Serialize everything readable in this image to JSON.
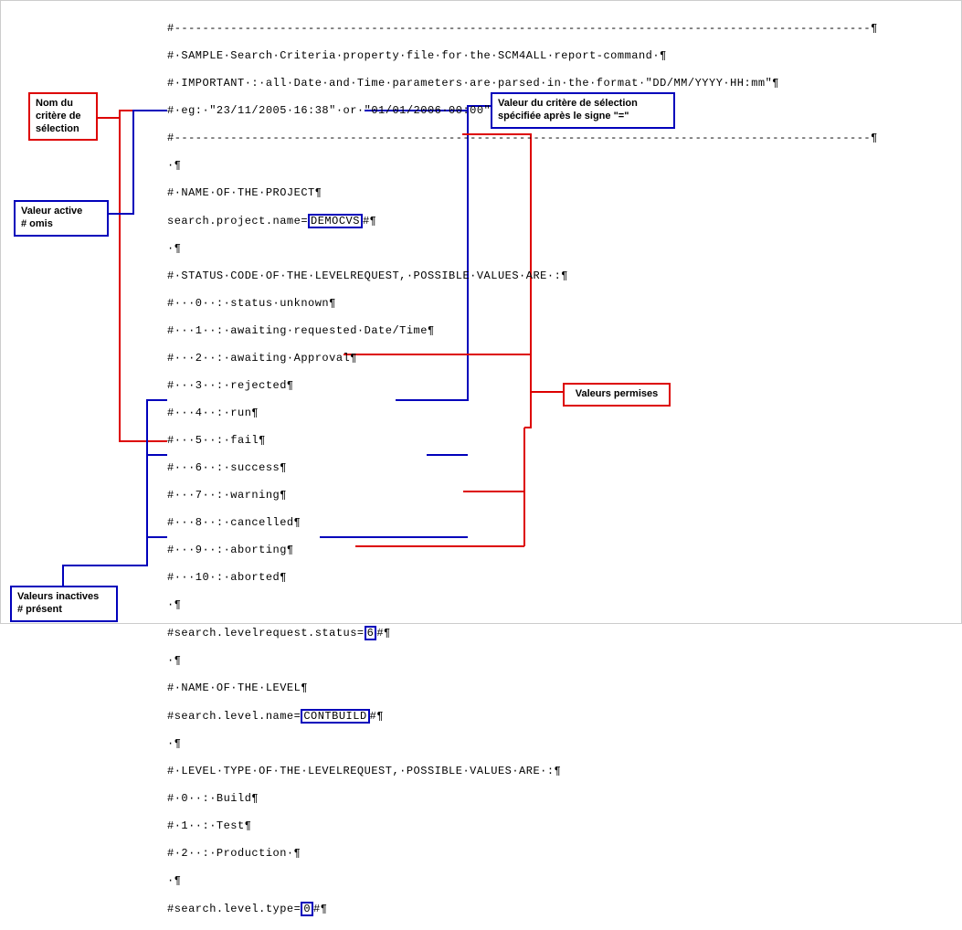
{
  "callouts": {
    "nom": "Nom du\ncritère de\nsélection",
    "valeur_active": "Valeur active\n# omis",
    "valeurs_inactives": "Valeurs inactives\n# présent",
    "valeur_critere": "Valeur du critère de sélection\nspécifiée après le signe \"=\"",
    "valeurs_permises": "Valeurs permises"
  },
  "values": {
    "project_name": "DEMOCVS",
    "lr_status": "6",
    "level_name": "CONTBUILD",
    "level_type": "0"
  },
  "code": {
    "l00": "#---------------------------------------------------------------------------------------------------¶",
    "l01": "#·SAMPLE·Search·Criteria·property·file·for·the·SCM4ALL·report-command·¶",
    "l02": "#·IMPORTANT·:·all·Date·and·Time·parameters·are·parsed·in·the·format·\"DD/MM/YYYY·HH:mm\"¶",
    "l03": "#·eg:·\"23/11/2005·16:38\"·or·\"01/01/2006·00:00\"¶",
    "l04": "#---------------------------------------------------------------------------------------------------¶",
    "l05": "·¶",
    "l06": "#·NAME·OF·THE·PROJECT¶",
    "l07a": "search.project.name=",
    "l07b": "#¶",
    "l08": "·¶",
    "l09": "#·STATUS·CODE·OF·THE·LEVELREQUEST,·POSSIBLE·VALUES·ARE·:¶",
    "l10": "#···0··:·status·unknown¶",
    "l11": "#···1··:·awaiting·requested·Date/Time¶",
    "l12": "#···2··:·awaiting·Approval¶",
    "l13": "#···3··:·rejected¶",
    "l14": "#···4··:·run¶",
    "l15": "#···5··:·fail¶",
    "l16": "#···6··:·success¶",
    "l17": "#···7··:·warning¶",
    "l18": "#···8··:·cancelled¶",
    "l19": "#···9··:·aborting¶",
    "l20": "#···10·:·aborted¶",
    "l21": "·¶",
    "l22a": "#search.levelrequest.status=",
    "l22b": "#¶",
    "l23": "·¶",
    "l24": "#·NAME·OF·THE·LEVEL¶",
    "l25a": "#search.level.name=",
    "l25b": "#¶",
    "l26": "·¶",
    "l27": "#·LEVEL·TYPE·OF·THE·LEVELREQUEST,·POSSIBLE·VALUES·ARE·:¶",
    "l28": "#·0··:·Build¶",
    "l29": "#·1··:·Test¶",
    "l30": "#·2··:·Production·¶",
    "l31": "·¶",
    "l32a": "#search.level.type=",
    "l32b": "#¶"
  }
}
